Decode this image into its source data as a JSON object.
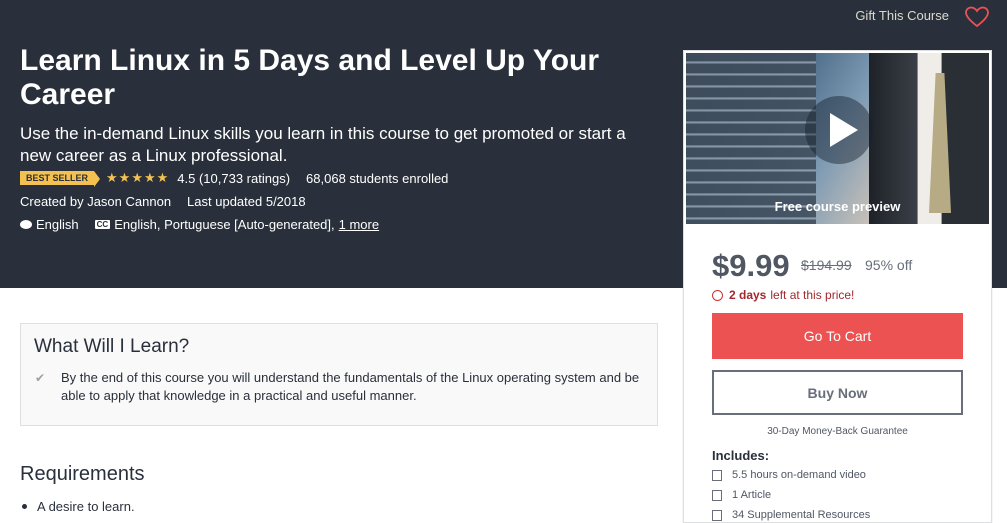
{
  "header": {
    "gift_label": "Gift This Course"
  },
  "course": {
    "title": "Learn Linux in 5 Days and Level Up Your Career",
    "subtitle": "Use the in-demand Linux skills you learn in this course to get promoted or start a new career as a Linux professional.",
    "badge": "BEST SELLER",
    "stars": "★★★★★",
    "rating": "4.5 (10,733 ratings)",
    "enrolled": "68,068 students enrolled",
    "created_by": "Created by Jason Cannon",
    "updated": "Last updated 5/2018",
    "language": "English",
    "captions": "English, Portuguese [Auto-generated],",
    "captions_more": "1 more",
    "cc_label": "CC"
  },
  "sidebar": {
    "preview_label": "Free course preview",
    "price": "$9.99",
    "original_price": "$194.99",
    "discount": "95% off",
    "time_left_bold": "2 days",
    "time_left_rest": "left at this price!",
    "cart_button": "Go To Cart",
    "buy_button": "Buy Now",
    "guarantee": "30-Day Money-Back Guarantee",
    "includes_title": "Includes:",
    "includes": [
      "5.5 hours on-demand video",
      "1 Article",
      "34 Supplemental Resources"
    ]
  },
  "main": {
    "learn_title": "What Will I Learn?",
    "learn_items": [
      "By the end of this course you will understand the fundamentals of the Linux operating system and be able to apply that knowledge in a practical and useful manner."
    ],
    "requirements_title": "Requirements",
    "requirements": [
      "A desire to learn."
    ]
  },
  "colors": {
    "hero_bg": "#29303b",
    "accent_red": "#ec5252",
    "star_yellow": "#f4c150"
  }
}
